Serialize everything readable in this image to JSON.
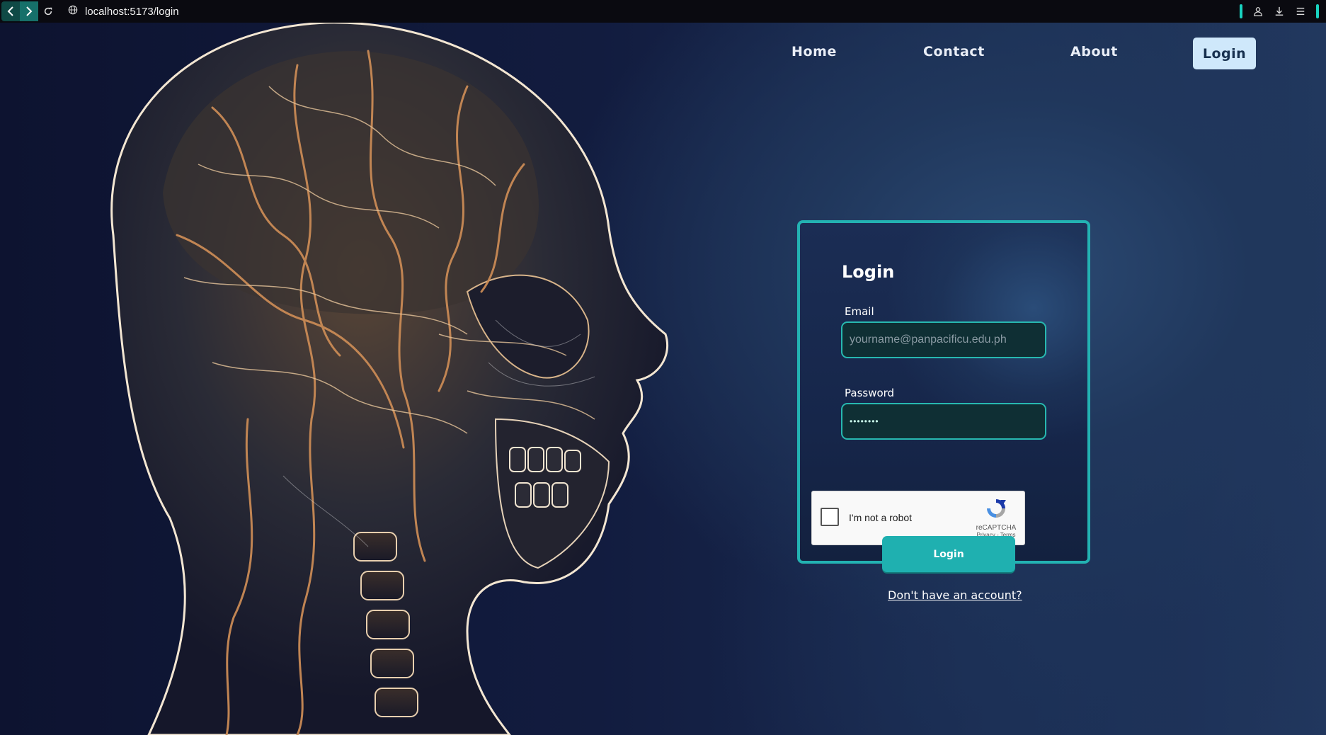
{
  "browser": {
    "url": "localhost:5173/login",
    "icons": [
      "back-arrow-icon",
      "forward-arrow-icon",
      "reload-icon",
      "globe-icon",
      "profile-icon",
      "download-icon",
      "menu-icon"
    ],
    "accent_color": "#19d3c0"
  },
  "nav": {
    "home": "Home",
    "contact": "Contact",
    "about": "About",
    "login": "Login"
  },
  "form": {
    "title": "Login",
    "email_label": "Email",
    "email_placeholder": "yourname@panpacificu.edu.ph",
    "email_value": "",
    "password_label": "Password",
    "password_value": "••••••••",
    "captcha_label": "I'm not a robot",
    "captcha_brand": "reCAPTCHA",
    "captcha_links": "Privacy - Terms",
    "submit": "Login",
    "signup_link": "Don't have an account?"
  },
  "colors": {
    "card_border": "#23b2b2",
    "button": "#1fb0b0",
    "nav_login_bg": "#cfe8fb",
    "background": "#0f1735"
  }
}
